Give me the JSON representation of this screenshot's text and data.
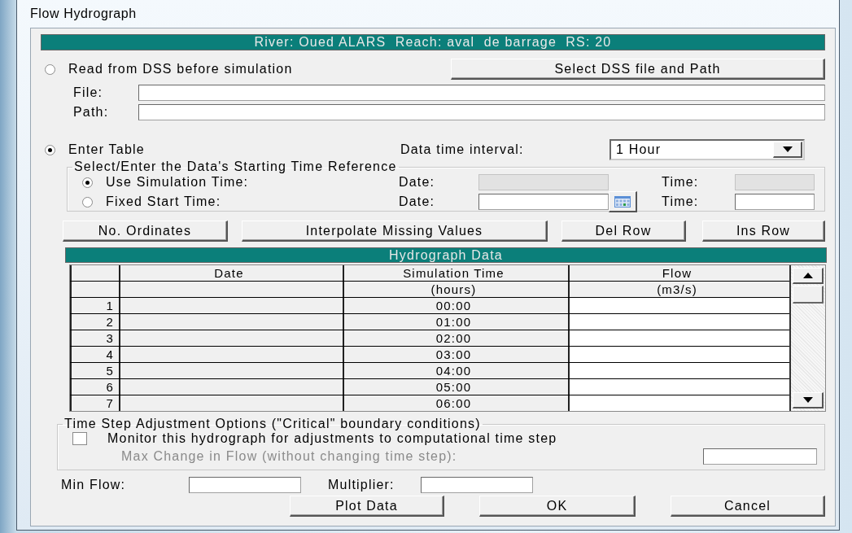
{
  "window": {
    "title": "Flow Hydrograph"
  },
  "location_banner": "River: Oued ALARS  Reach: aval  de barrage  RS: 20",
  "dss": {
    "option": {
      "label": "Read from DSS before simulation",
      "selected": false
    },
    "select_button": "Select DSS file and Path",
    "file_label": "File:",
    "path_label": "Path:"
  },
  "table_option": {
    "label": "Enter Table",
    "selected": true
  },
  "interval": {
    "label": "Data time interval:",
    "value": "1 Hour"
  },
  "time_reference": {
    "legend": "Select/Enter the Data's Starting Time Reference",
    "options": [
      {
        "label": "Use Simulation Time:",
        "selected": true,
        "date_label": "Date:",
        "time_label": "Time:",
        "disabled": true
      },
      {
        "label": "Fixed Start Time:",
        "selected": false,
        "date_label": "Date:",
        "time_label": "Time:",
        "disabled": false
      }
    ]
  },
  "table_buttons": [
    "No. Ordinates",
    "Interpolate Missing Values",
    "Del Row",
    "Ins Row"
  ],
  "hydrograph": {
    "title": "Hydrograph Data",
    "columns": [
      {
        "label": "Date"
      },
      {
        "label": "Simulation Time",
        "unit": "(hours)"
      },
      {
        "label": "Flow",
        "unit": "(m3/s)"
      }
    ],
    "rows": [
      {
        "number": "1",
        "time": "00:00"
      },
      {
        "number": "2",
        "time": "01:00"
      },
      {
        "number": "3",
        "time": "02:00"
      },
      {
        "number": "4",
        "time": "03:00"
      },
      {
        "number": "5",
        "time": "04:00"
      },
      {
        "number": "6",
        "time": "05:00"
      },
      {
        "number": "7",
        "time": "06:00"
      }
    ]
  },
  "time_step": {
    "legend": "Time Step Adjustment Options (\"Critical\" boundary conditions)",
    "monitor": {
      "label": "Monitor this hydrograph for adjustments to computational time step",
      "checked": false
    },
    "max_change": {
      "label": "Max Change in Flow (without changing time step):",
      "disabled": true
    }
  },
  "min_flow_label": "Min Flow:",
  "multiplier_label": "Multiplier:",
  "buttons": [
    "Plot Data",
    "OK",
    "Cancel"
  ]
}
